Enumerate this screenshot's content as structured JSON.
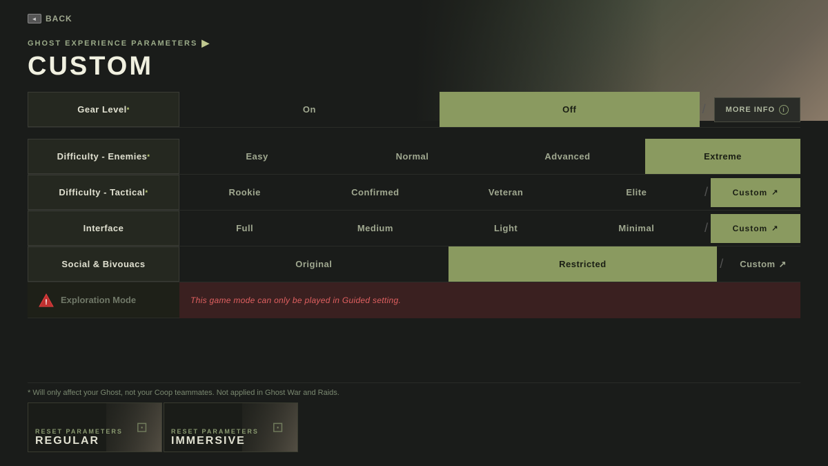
{
  "back": {
    "label": "BACK",
    "icon": "back-icon"
  },
  "header": {
    "subtitle": "GHOST EXPERIENCE PARAMETERS",
    "title": "CUSTOM"
  },
  "settings": {
    "gear_level": {
      "label": "Gear Level",
      "asterisk": true,
      "options": [
        "On",
        "Off"
      ],
      "active": "Off",
      "more_info": "MORE INFO"
    },
    "difficulty_enemies": {
      "label": "Difficulty - Enemies",
      "asterisk": true,
      "options": [
        "Easy",
        "Normal",
        "Advanced",
        "Extreme"
      ],
      "active": "Extreme"
    },
    "difficulty_tactical": {
      "label": "Difficulty - Tactical",
      "asterisk": true,
      "options": [
        "Rookie",
        "Confirmed",
        "Veteran",
        "Elite"
      ],
      "active": null,
      "custom_label": "Custom"
    },
    "interface": {
      "label": "Interface",
      "options": [
        "Full",
        "Medium",
        "Light",
        "Minimal"
      ],
      "active": null,
      "custom_label": "Custom"
    },
    "social_bivouacs": {
      "label": "Social & Bivouacs",
      "options": [
        "Original",
        "Restricted"
      ],
      "active": "Restricted",
      "custom_label": "Custom"
    },
    "exploration_mode": {
      "label": "Exploration Mode",
      "warning": "This game mode can only be played in Guided setting."
    }
  },
  "footnote": "* Will only affect your Ghost, not your Coop teammates. Not applied in Ghost War and Raids.",
  "presets": [
    {
      "small_label": "RESET PARAMETERS",
      "large_label": "REGULAR"
    },
    {
      "small_label": "RESET PARAMETERS",
      "large_label": "IMMERSIVE"
    }
  ],
  "icons": {
    "arrow": "▶",
    "external": "↗",
    "info": "i",
    "warning": "▲",
    "monitor": "⊡",
    "back_box": "◄"
  },
  "colors": {
    "active_bg": "#8a9a60",
    "active_text": "#1a1e14",
    "label_bg": "#252820",
    "warning_bg": "#3a2020",
    "warning_text": "#e06060"
  }
}
